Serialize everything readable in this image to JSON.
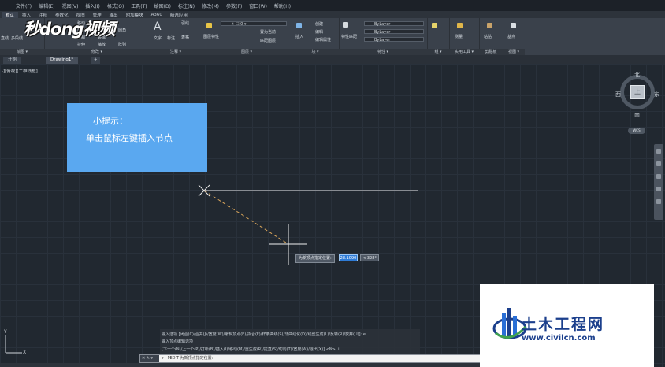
{
  "menubar": [
    "文件(F)",
    "编辑(E)",
    "视图(V)",
    "插入(I)",
    "格式(O)",
    "工具(T)",
    "绘图(D)",
    "标注(N)",
    "修改(M)",
    "参数(P)",
    "窗口(W)",
    "帮助(H)"
  ],
  "ribbon_tabs": [
    "默认",
    "插入",
    "注释",
    "参数化",
    "视图",
    "管理",
    "输出",
    "附加模块",
    "A360",
    "精选应用"
  ],
  "ribbon": {
    "draw": {
      "tools": [
        "直线",
        "多段线"
      ],
      "label": "绘图 ▾"
    },
    "modify": {
      "tools": [
        "移动",
        "旋转",
        "修剪",
        "复制",
        "镜像",
        "圆角",
        "拉伸",
        "缩放",
        "阵列"
      ],
      "label": "修改 ▾"
    },
    "annotation": {
      "text": "文字",
      "dim": "标注",
      "leader": "引线",
      "table": "表格",
      "label": "注释 ▾"
    },
    "layers": {
      "props": "图层特性",
      "match": "置为当前",
      "copy": "匹配图层",
      "label": "图层 ▾"
    },
    "block": {
      "insert": "插入",
      "create": "创建",
      "edit": "编辑",
      "attr": "编辑属性",
      "label": "块 ▾"
    },
    "properties": {
      "match": "特性匹配",
      "bylayer1": "ByLayer",
      "bylayer2": "ByLayer",
      "bylayer3": "ByLayer",
      "label": "特性 ▾"
    },
    "groups": {
      "label": "组 ▾"
    },
    "utilities": {
      "measure": "测量",
      "label": "实用工具 ▾"
    },
    "clipboard": {
      "paste": "粘贴",
      "label": "剪贴板"
    },
    "view": {
      "base": "基点",
      "label": "视图 ▾"
    }
  },
  "watermark": "秒dong视频",
  "file_tabs": [
    "开始",
    "Drawing1*"
  ],
  "view_label": "-][俯视][二维线框]",
  "tip": {
    "title": "小提示：",
    "body": "单击鼠标左键插入节点"
  },
  "viewcube": {
    "north": "北",
    "south": "南",
    "east": "东",
    "west": "西",
    "face": "上",
    "wcs": "WCS"
  },
  "dyn_input": {
    "prompt": "为新顶点指定位置:",
    "length": "28.1090",
    "angle": "< 328°"
  },
  "command_history": [
    "输入选项 [闭合(C)/合并(J)/宽度(W)/编辑顶点(E)/拟合(F)/样条曲线(S)/非曲线化(D)/线型生成(L)/反转(R)/放弃(U)]: e",
    "输入顶点编辑选项",
    "[下一个(N)/上一个(P)/打断(B)/插入(I)/移动(M)/重生成(R)/拉直(S)/切向(T)/宽度(W)/退出(X)] <N>: i"
  ],
  "command_line": {
    "buttons": "✕ ✎ ▾",
    "text": "▾ - PEDIT 为新顶点指定位置:"
  },
  "ucs": {
    "x": "X",
    "y": "Y"
  },
  "logo": {
    "name": "土木工程网",
    "url": "www.civilcn.com"
  },
  "colors": {
    "canvas": "#212830",
    "tip_box": "#5aa8f0",
    "logo_blue": "#1b3f8c",
    "line_white": "#e8e8e8",
    "rubberband": "#d9a55a"
  }
}
